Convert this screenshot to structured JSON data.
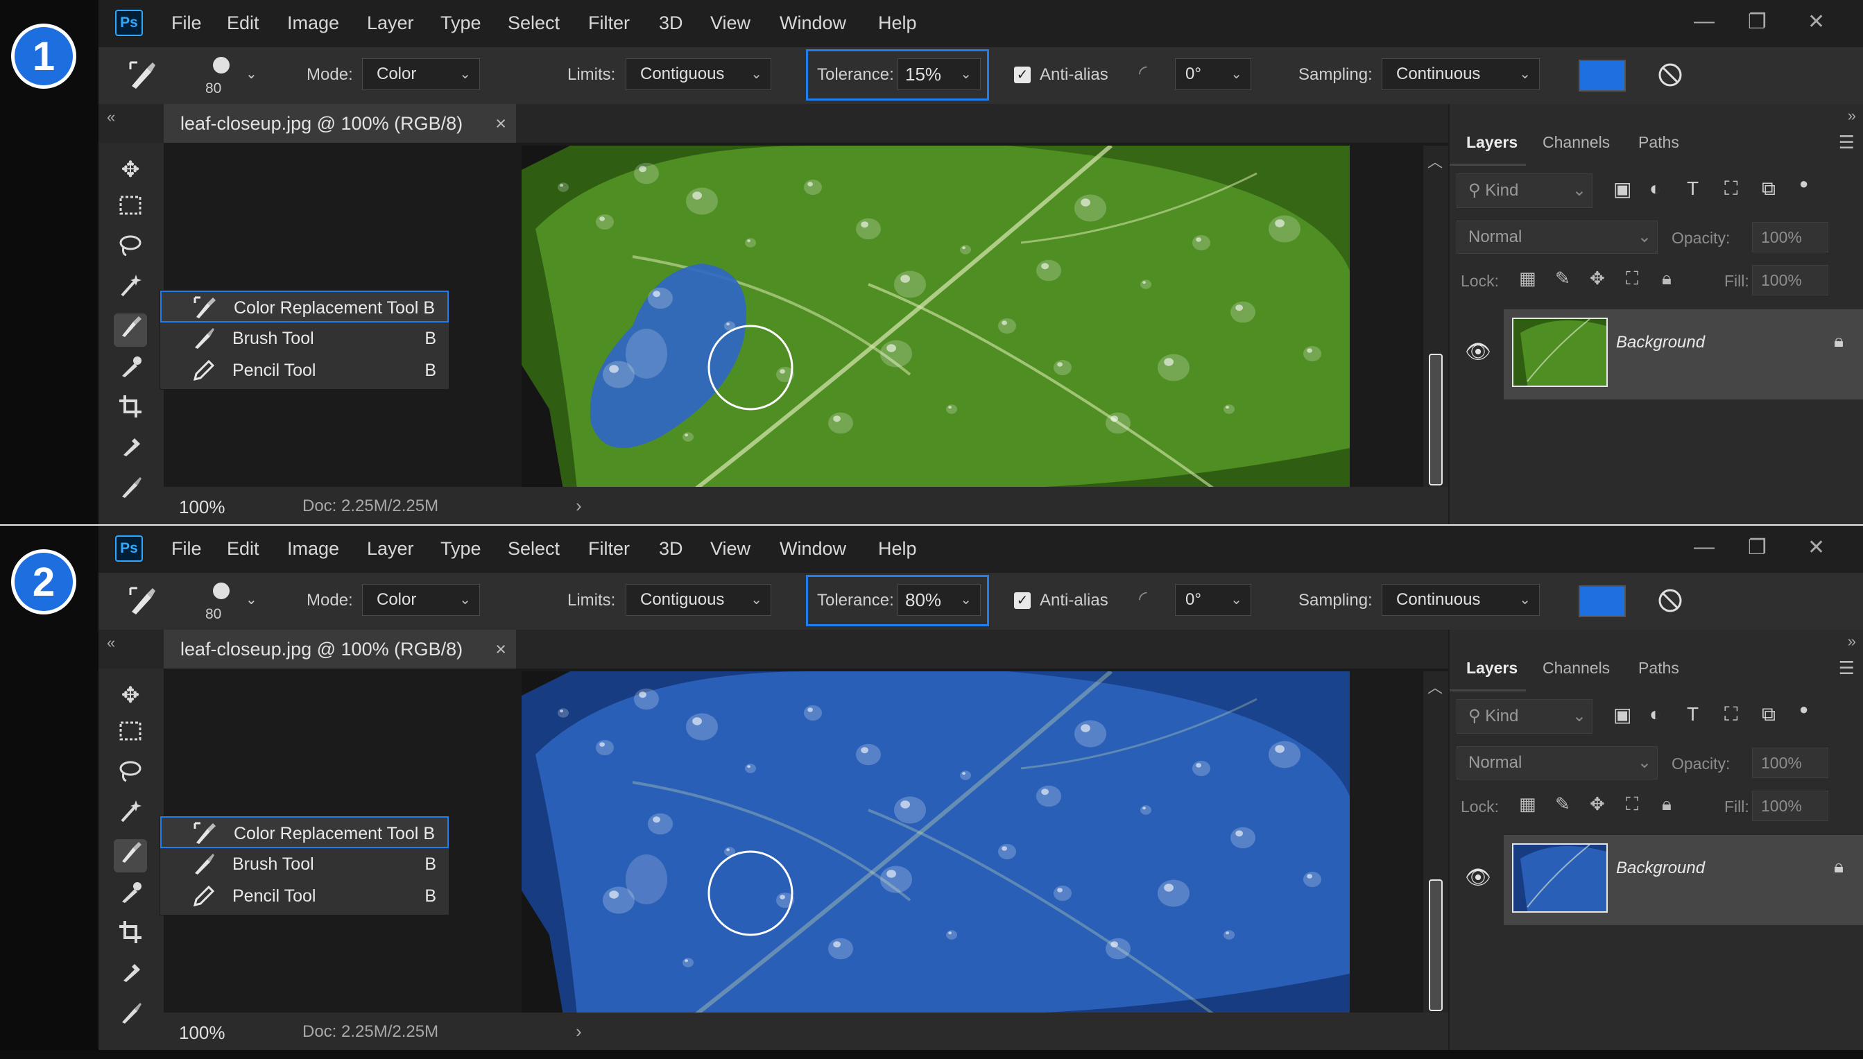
{
  "panels": [
    {
      "step": "1",
      "menu": [
        "File",
        "Edit",
        "Image",
        "Layer",
        "Type",
        "Select",
        "Filter",
        "3D",
        "View",
        "Window",
        "Help"
      ],
      "app_logo": "Ps",
      "window_controls": {
        "minimize": "—",
        "restore": "❐",
        "close": "✕"
      },
      "options": {
        "brush_size": "80",
        "mode_label": "Mode:",
        "mode_value": "Color",
        "limits_label": "Limits:",
        "limits_value": "Contiguous",
        "tolerance_label": "Tolerance:",
        "tolerance_value": "15%",
        "antialias_label": "Anti-alias",
        "antialias_checked": true,
        "angle_value": "0°",
        "sampling_label": "Sampling:",
        "sampling_value": "Continuous",
        "color_swatch": "#1e70e0"
      },
      "doc_tab": {
        "title": "leaf-closeup.jpg @ 100% (RGB/8)",
        "close": "×"
      },
      "status": {
        "zoom": "100%",
        "doc": "Doc: 2.25M/2.25M"
      },
      "flyout": [
        {
          "name": "Color Replacement Tool",
          "key": "B"
        },
        {
          "name": "Brush Tool",
          "key": "B"
        },
        {
          "name": "Pencil Tool",
          "key": "B"
        }
      ],
      "layers": {
        "tabs": [
          "Layers",
          "Channels",
          "Paths"
        ],
        "kind": "Kind",
        "blend": "Normal",
        "opacity_label": "Opacity:",
        "opacity": "100%",
        "lock_label": "Lock:",
        "fill_label": "Fill:",
        "fill": "100%",
        "layer_name": "Background"
      },
      "leaf_recolor": "partial",
      "colors": {
        "leaf": "#4f8e22",
        "leaf_dark": "#2f5e12",
        "replacement": "#2f66c8"
      }
    },
    {
      "step": "2",
      "menu": [
        "File",
        "Edit",
        "Image",
        "Layer",
        "Type",
        "Select",
        "Filter",
        "3D",
        "View",
        "Window",
        "Help"
      ],
      "app_logo": "Ps",
      "window_controls": {
        "minimize": "—",
        "restore": "❐",
        "close": "✕"
      },
      "options": {
        "brush_size": "80",
        "mode_label": "Mode:",
        "mode_value": "Color",
        "limits_label": "Limits:",
        "limits_value": "Contiguous",
        "tolerance_label": "Tolerance:",
        "tolerance_value": "80%",
        "antialias_label": "Anti-alias",
        "antialias_checked": true,
        "angle_value": "0°",
        "sampling_label": "Sampling:",
        "sampling_value": "Continuous",
        "color_swatch": "#1e70e0"
      },
      "doc_tab": {
        "title": "leaf-closeup.jpg @ 100% (RGB/8)",
        "close": "×"
      },
      "status": {
        "zoom": "100%",
        "doc": "Doc: 2.25M/2.25M"
      },
      "flyout": [
        {
          "name": "Color Replacement Tool",
          "key": "B"
        },
        {
          "name": "Brush Tool",
          "key": "B"
        },
        {
          "name": "Pencil Tool",
          "key": "B"
        }
      ],
      "layers": {
        "tabs": [
          "Layers",
          "Channels",
          "Paths"
        ],
        "kind": "Kind",
        "blend": "Normal",
        "opacity_label": "Opacity:",
        "opacity": "100%",
        "lock_label": "Lock:",
        "fill_label": "Fill:",
        "fill": "100%",
        "layer_name": "Background"
      },
      "leaf_recolor": "full",
      "colors": {
        "leaf": "#2a5fb8",
        "leaf_dark": "#173c82",
        "replacement": "#2f66c8"
      }
    }
  ]
}
